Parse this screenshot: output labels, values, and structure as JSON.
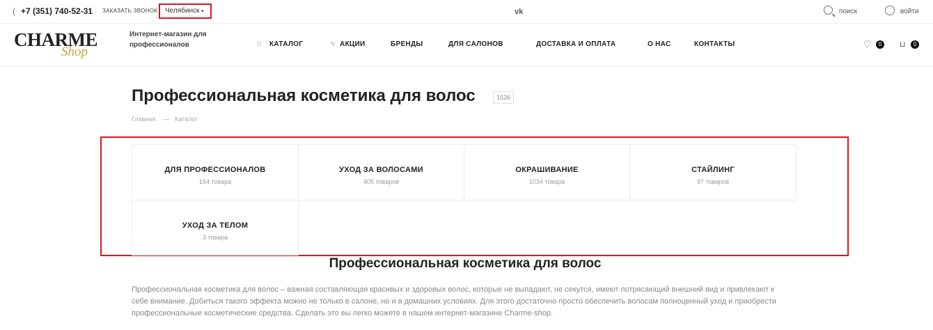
{
  "topbar": {
    "phone": "+7 (351) 740-52-31",
    "callback": "ЗАКАЗАТЬ ЗВОНОК",
    "city": "Челябинск",
    "social": "vk",
    "search": "поиск",
    "login": "войти"
  },
  "header": {
    "logo_main": "CHARME",
    "logo_sub": "Shop",
    "tagline": "Интернет-магазин для профессионалов",
    "nav": [
      "КАТАЛОГ",
      "АКЦИИ",
      "БРЕНДЫ",
      "ДЛЯ САЛОНОВ",
      "ДОСТАВКА И ОПЛАТА",
      "О НАС",
      "КОНТАКТЫ"
    ],
    "favorites_count": "0",
    "cart_count": "0"
  },
  "page": {
    "title": "Профессиональная косметика для волос",
    "count": "1526",
    "breadcrumbs": [
      "Главная",
      "—",
      "Каталог"
    ]
  },
  "categories": [
    {
      "name": "ДЛЯ ПРОФЕССИОНАЛОВ",
      "count": "154 товара"
    },
    {
      "name": "УХОД ЗА ВОЛОСАМИ",
      "count": "405 товаров"
    },
    {
      "name": "ОКРАШИВАНИЕ",
      "count": "1034 товара"
    },
    {
      "name": "СТАЙЛИНГ",
      "count": "97 товаров"
    },
    {
      "name": "УХОД ЗА ТЕЛОМ",
      "count": "3 товара"
    }
  ],
  "seo": {
    "title": "Профессиональная косметика для волос",
    "text": "Профессиональная косметика для волос – важная составляющая красивых и здоровых волос, которые не выпадают, не секутся, имеют потрясающий внешний вид и привлекают к себе внимание. Добиться такого эффекта можно не только в салоне, но и в домашних условиях. Для этого достаточно просто обеспечить волосам полноценный уход и приобрести профессиональные косметические средства. Сделать это вы легко можете в нашем интернет-магазине Charme-shop."
  },
  "colors": {
    "highlight": "#e0141e",
    "logo_gold": "#c9a23a"
  }
}
